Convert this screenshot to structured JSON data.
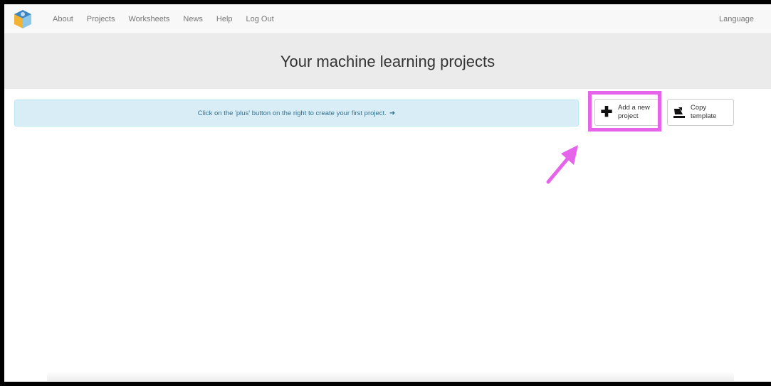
{
  "navbar": {
    "links": [
      "About",
      "Projects",
      "Worksheets",
      "News",
      "Help",
      "Log Out"
    ],
    "language_label": "Language"
  },
  "header": {
    "title": "Your machine learning projects"
  },
  "alert": {
    "text": "Click on the 'plus' button on the right to create your first project.",
    "arrow_icon": "arrow-right-icon"
  },
  "actions": {
    "add_label_line1": "Add a new",
    "add_label_line2": "project",
    "copy_label_line1": "Copy",
    "copy_label_line2": "template"
  },
  "annotation": {
    "highlight_color": "#e664ea"
  },
  "colors": {
    "alert_bg": "#d9edf7",
    "alert_text": "#31708f",
    "header_bg": "#ebebeb"
  }
}
